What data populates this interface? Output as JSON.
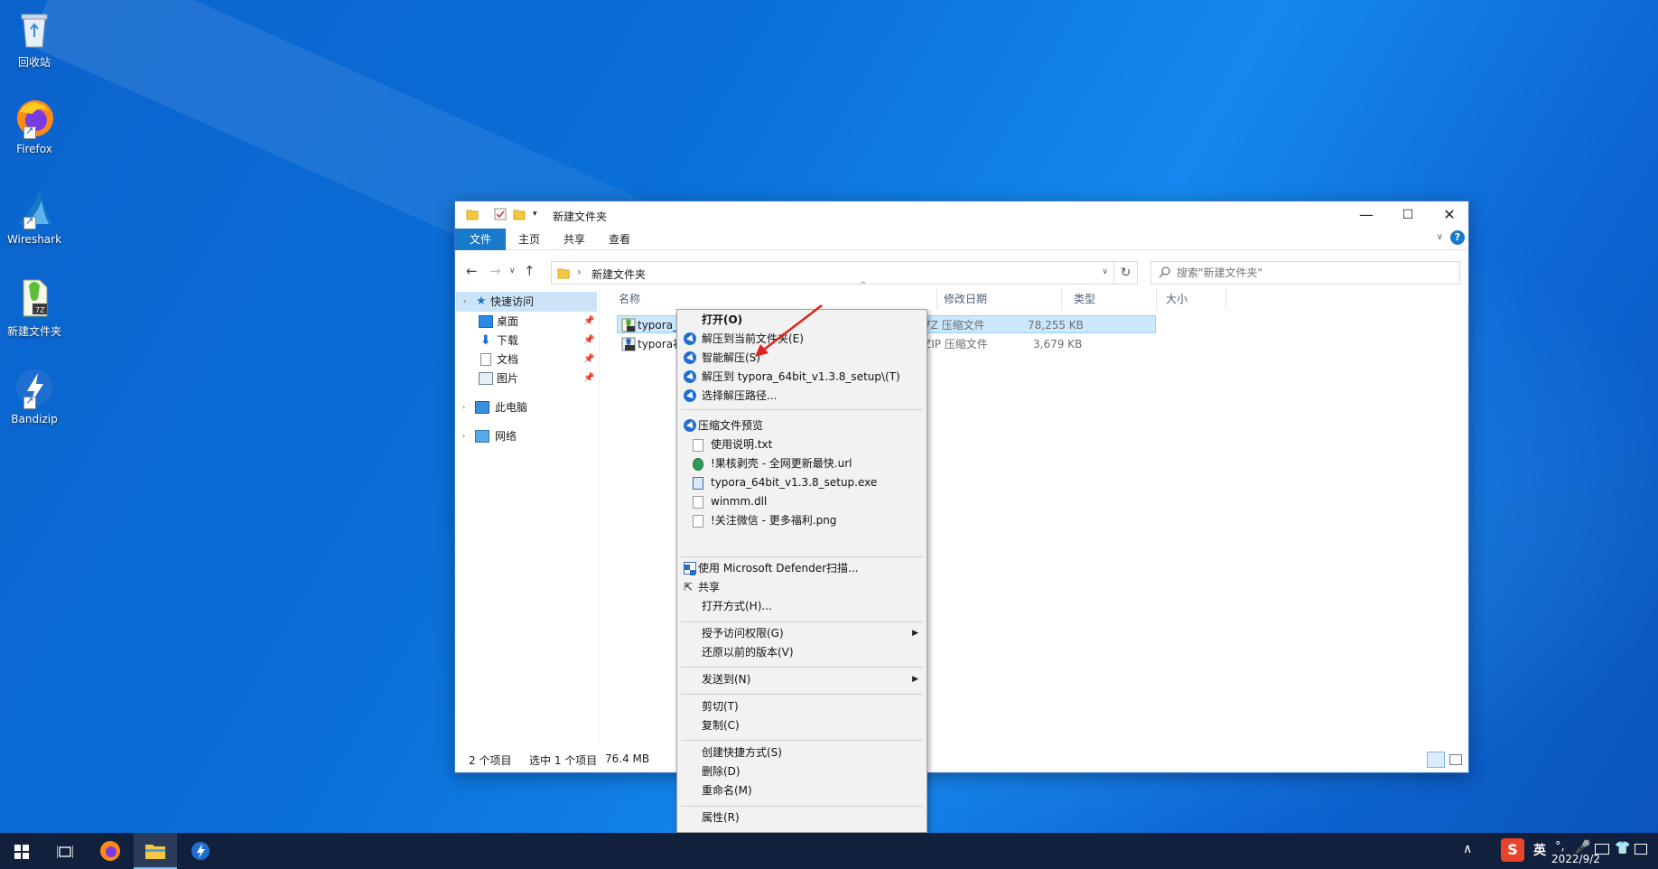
{
  "desktop": {
    "icons": [
      {
        "label": "回收站",
        "icon": "recycle-bin-icon"
      },
      {
        "label": "Firefox",
        "icon": "firefox-icon"
      },
      {
        "label": "Wireshark",
        "icon": "wireshark-icon"
      },
      {
        "label": "新建文件夹",
        "icon": "7z-archive-icon"
      },
      {
        "label": "Bandizip",
        "icon": "bandizip-icon"
      }
    ]
  },
  "window": {
    "title": "新建文件夹",
    "controls": {
      "minimize": "—",
      "maximize": "☐",
      "close": "✕"
    },
    "ribbon_tabs": [
      "文件",
      "主页",
      "共享",
      "查看"
    ],
    "address": {
      "path": "新建文件夹"
    },
    "search": {
      "placeholder": "搜索\"新建文件夹\""
    },
    "navpane": {
      "items": [
        {
          "label": "快速访问",
          "icon": "star-icon"
        },
        {
          "label": "桌面",
          "icon": "desktop-icon"
        },
        {
          "label": "下载",
          "icon": "download-icon"
        },
        {
          "label": "文档",
          "icon": "document-icon"
        },
        {
          "label": "图片",
          "icon": "pictures-icon"
        },
        {
          "label": "此电脑",
          "icon": "computer-icon"
        },
        {
          "label": "网络",
          "icon": "network-icon"
        }
      ]
    },
    "columns": [
      "名称",
      "修改日期",
      "类型",
      "大小"
    ],
    "files": [
      {
        "name": "typora_6",
        "type": "7Z 压缩文件",
        "size": "78,255 KB"
      },
      {
        "name": "typora补",
        "type": "ZIP 压缩文件",
        "size": "3,679 KB"
      }
    ],
    "status": {
      "count": "2 个项目",
      "selected": "选中 1 个项目",
      "selected_size": "76.4 MB"
    }
  },
  "context_menu": {
    "open": "打开(O)",
    "bandizip": [
      "解压到当前文件夹(E)",
      "智能解压(S)",
      "解压到 typora_64bit_v1.3.8_setup\\(T)",
      "选择解压路径..."
    ],
    "preview_title": "压缩文件预览",
    "preview_files": [
      "使用说明.txt",
      "!果核剥壳 - 全网更新最快.url",
      "typora_64bit_v1.3.8_setup.exe",
      "winmm.dll",
      "!关注微信 - 更多福利.png"
    ],
    "defender": "使用 Microsoft Defender扫描...",
    "share": "共享",
    "open_with": "打开方式(H)...",
    "grant_access": "授予访问权限(G)",
    "restore": "还原以前的版本(V)",
    "send_to": "发送到(N)",
    "cut": "剪切(T)",
    "copy": "复制(C)",
    "create_shortcut": "创建快捷方式(S)",
    "delete": "删除(D)",
    "rename": "重命名(M)",
    "properties": "属性(R)"
  },
  "taskbar": {
    "ime_label": "英",
    "date": "2022/9/2"
  },
  "colors": {
    "accent": "#1979ca",
    "selection": "#cce8ff",
    "taskbar": "#11203d",
    "arrow": "#e0201a"
  }
}
